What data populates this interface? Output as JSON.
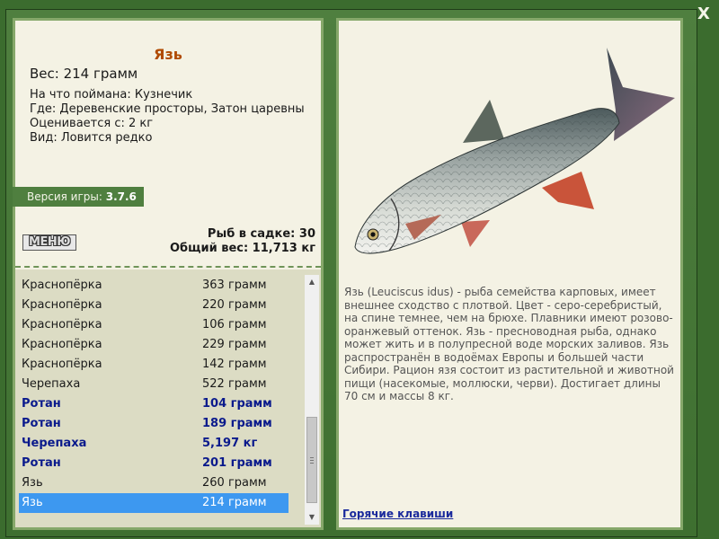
{
  "close_label": "X",
  "fish": {
    "name": "Язь",
    "weight": "Вес: 214 грамм",
    "bait": "На что поймана: Кузнечик",
    "location": "Где: Деревенские просторы, Затон царевны",
    "value": "Оценивается с: 2 кг",
    "view": "Вид: Ловится редко"
  },
  "version": {
    "label": "Версия игры:",
    "number": "3.7.6"
  },
  "menu_label": "МЕНЮ",
  "stats": {
    "count": "Рыб в садке: 30",
    "total": "Общий вес: 11,713 кг"
  },
  "list": [
    {
      "name": "Краснопёрка",
      "weight": "363 грамм"
    },
    {
      "name": "Краснопёрка",
      "weight": "220 грамм"
    },
    {
      "name": "Краснопёрка",
      "weight": "106 грамм"
    },
    {
      "name": "Краснопёрка",
      "weight": "229 грамм"
    },
    {
      "name": "Краснопёрка",
      "weight": "142 грамм"
    },
    {
      "name": "Черепаха",
      "weight": "522 грамм"
    },
    {
      "name": "Ротан",
      "weight": "104 грамм"
    },
    {
      "name": "Ротан",
      "weight": "189 грамм"
    },
    {
      "name": "Черепаха",
      "weight": "5,197 кг"
    },
    {
      "name": "Ротан",
      "weight": "201 грамм"
    },
    {
      "name": "Язь",
      "weight": "260 грамм"
    },
    {
      "name": "Язь",
      "weight": "214 грамм"
    }
  ],
  "description": "Язь (Leuciscus idus) - рыба семейства карповых, имеет внешнее сходство с плотвой. Цвет - серо-серебристый, на спине темнее, чем на брюхе. Плавники имеют розово-оранжевый оттенок. Язь - пресноводная рыба, однако может жить и в полупресной воде морских заливов. Язь распространён в водоёмах Европы и большей части Сибири. Рацион язя состоит из растительной и животной пищи (насекомые, моллюски, черви). Достигает длины 70 см и массы 8 кг.",
  "hotkeys_label": "Горячие клавиши",
  "icons": {
    "close": "close-icon",
    "scroll_up": "triangle-up-icon",
    "scroll_down": "triangle-down-icon"
  },
  "colors": {
    "frame": "#3b6c2e",
    "panel": "#f4f2e4",
    "fish_name": "#b04a00",
    "rare_text": "#0a1a8c",
    "selected_row": "#3d98f0",
    "link": "#1a2a9c"
  }
}
